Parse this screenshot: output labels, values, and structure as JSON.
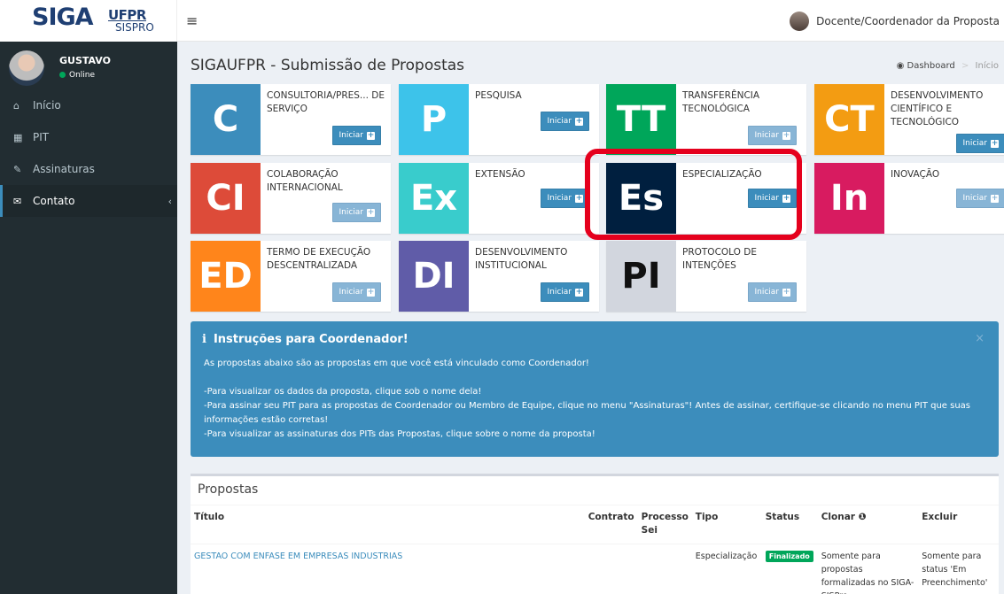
{
  "header": {
    "logo_siga": "SIGA",
    "logo_ufpr": "UFPR",
    "logo_sispro": "SISPRO",
    "menu_toggle": "≡",
    "role": "Docente/Coordenador da Proposta"
  },
  "sidebar": {
    "user_name": "GUSTAVO",
    "user_status": "Online",
    "items": [
      {
        "label": "Início",
        "icon": "home-icon"
      },
      {
        "label": "PIT",
        "icon": "grid-icon"
      },
      {
        "label": "Assinaturas",
        "icon": "edit-icon"
      },
      {
        "label": "Contato",
        "icon": "envelope-icon"
      }
    ]
  },
  "page": {
    "title": "SIGAUFPR - Submissão de Propostas",
    "breadcrumb_dashboard": "Dashboard",
    "breadcrumb_current": "Início"
  },
  "cards": [
    {
      "abbr": "C",
      "label": "CONSULTORIA/PRES... DE SERVIÇO",
      "color": "#3c8dbc",
      "button": "Iniciar"
    },
    {
      "abbr": "P",
      "label": "PESQUISA",
      "color": "#3dc3ea",
      "button": "Iniciar"
    },
    {
      "abbr": "TT",
      "label": "TRANSFERÊNCIA TECNOLÓGICA",
      "color": "#00a65a",
      "button": "Iniciar"
    },
    {
      "abbr": "CT",
      "label": "DESENVOLVIMENTO CIENTÍFICO E TECNOLÓGICO",
      "color": "#f39c12",
      "button": "Iniciar"
    },
    {
      "abbr": "CI",
      "label": "COLABORAÇÃO INTERNACIONAL",
      "color": "#dd4b39",
      "button": "Iniciar"
    },
    {
      "abbr": "Ex",
      "label": "EXTENSÃO",
      "color": "#39cccc",
      "button": "Iniciar"
    },
    {
      "abbr": "Es",
      "label": "ESPECIALIZAÇÃO",
      "color": "#001f3f",
      "button": "Iniciar"
    },
    {
      "abbr": "In",
      "label": "INOVAÇÃO",
      "color": "#d81b60",
      "button": "Iniciar"
    },
    {
      "abbr": "ED",
      "label": "TERMO DE EXECUÇÃO DESCENTRALIZADA",
      "color": "#ff851b",
      "button": "Iniciar"
    },
    {
      "abbr": "DI",
      "label": "DESENVOLVIMENTO INSTITUCIONAL",
      "color": "#605ca8",
      "button": "Iniciar"
    },
    {
      "abbr": "PI",
      "label": "PROTOCOLO DE INTENÇÕES",
      "color": "#d2d6de",
      "button": "Iniciar"
    }
  ],
  "callout": {
    "title": "Instruções para Coordenador!",
    "close": "×",
    "lines": [
      "As propostas abaixo são as propostas em que você está vinculado como Coordenador!",
      "",
      "-Para visualizar os dados da proposta, clique sob o nome dela!",
      "-Para assinar seu PIT para as propostas de Coordenador ou Membro de Equipe, clique no menu \"Assinaturas\"! Antes de assinar, certifique-se clicando no menu PIT que suas informações estão corretas!",
      "-Para visualizar as assinaturas dos PITs das Propostas, clique sobre o nome da proposta!"
    ]
  },
  "proposals": {
    "title": "Propostas",
    "columns": [
      "Título",
      "Contrato",
      "Processo Sei",
      "Tipo",
      "Status",
      "Clonar",
      "Excluir"
    ],
    "rows": [
      {
        "titulo": "GESTAO COM ENFASE EM EMPRESAS INDUSTRIAS",
        "contrato": "",
        "processo": "",
        "tipo": "Especialização",
        "status": "Finalizado",
        "clonar": "Somente para propostas formalizadas no SIGA-SISPro",
        "excluir": "Somente para status 'Em Preenchimento'"
      }
    ]
  }
}
